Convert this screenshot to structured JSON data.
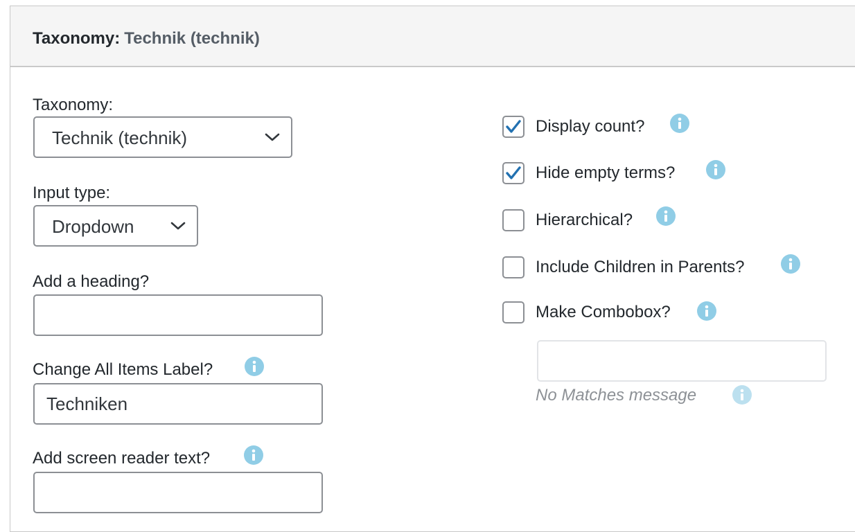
{
  "header": {
    "label": "Taxonomy:",
    "value": "Technik (technik)"
  },
  "left": {
    "taxonomy": {
      "label": "Taxonomy:",
      "selected": "Technik (technik)"
    },
    "input_type": {
      "label": "Input type:",
      "selected": "Dropdown"
    },
    "heading": {
      "label": "Add a heading?",
      "value": ""
    },
    "all_items": {
      "label": "Change All Items Label?",
      "value": "Techniken"
    },
    "screen_reader": {
      "label": "Add screen reader text?",
      "value": ""
    }
  },
  "right": {
    "options": [
      {
        "label": "Display count?",
        "checked": true
      },
      {
        "label": "Hide empty terms?",
        "checked": true
      },
      {
        "label": "Hierarchical?",
        "checked": false
      },
      {
        "label": "Include Children in Parents?",
        "checked": false
      },
      {
        "label": "Make Combobox?",
        "checked": false
      }
    ],
    "no_matches": {
      "value": "",
      "caption": "No Matches message"
    }
  },
  "icons": {
    "info": "info-icon",
    "chevron": "chevron-down-icon",
    "check": "checkmark-icon"
  },
  "colors": {
    "info": "#90cde6",
    "check": "#2271b1",
    "border": "#8c8f94",
    "header_bg": "#f5f5f5"
  }
}
